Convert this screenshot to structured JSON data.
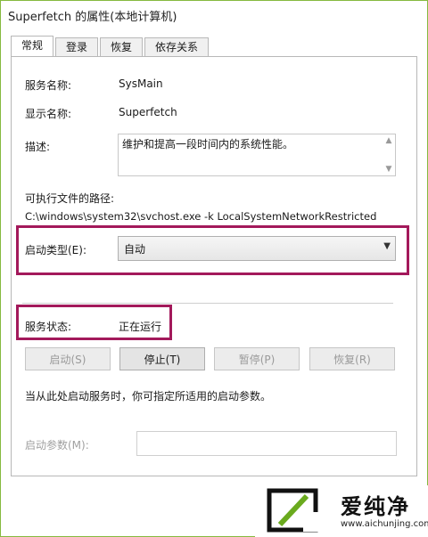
{
  "window": {
    "title": "Superfetch 的属性(本地计算机)"
  },
  "tabs": [
    {
      "label": "常规",
      "active": true
    },
    {
      "label": "登录",
      "active": false
    },
    {
      "label": "恢复",
      "active": false
    },
    {
      "label": "依存关系",
      "active": false
    }
  ],
  "general": {
    "service_name_label": "服务名称:",
    "service_name_value": "SysMain",
    "display_name_label": "显示名称:",
    "display_name_value": "Superfetch",
    "description_label": "描述:",
    "description_value": "维护和提高一段时间内的系统性能。",
    "path_label": "可执行文件的路径:",
    "path_value": "C:\\windows\\system32\\svchost.exe -k LocalSystemNetworkRestricted",
    "startup_type_label": "启动类型(E):",
    "startup_type_value": "自动",
    "status_label": "服务状态:",
    "status_value": "正在运行",
    "buttons": {
      "start": "启动(S)",
      "stop": "停止(T)",
      "pause": "暂停(P)",
      "resume": "恢复(R)"
    },
    "hint": "当从此处启动服务时，你可指定所适用的启动参数。",
    "start_params_label": "启动参数(M):"
  },
  "watermark": {
    "logo_text": "爱纯净",
    "url": "www.aichunjing.com"
  },
  "colors": {
    "window_border": "#86ba3f",
    "highlight": "#a3195b"
  }
}
